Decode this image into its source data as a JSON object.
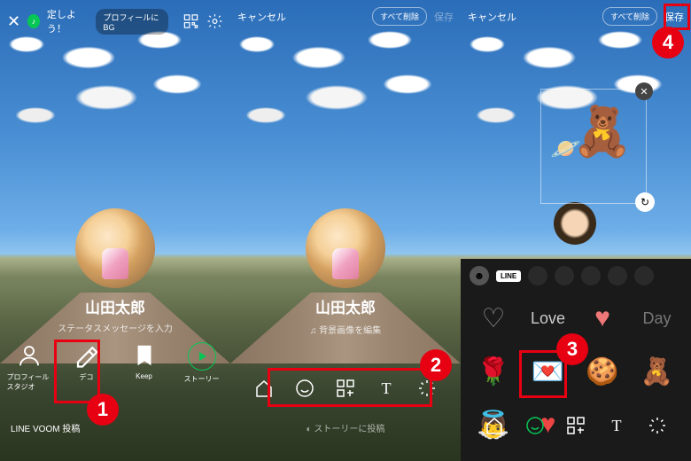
{
  "panel1": {
    "topbar": {
      "music_prompt": "定しよう！",
      "profile_bgm": "プロフィールにBG"
    },
    "profile": {
      "name": "山田太郎",
      "status": "ステータスメッセージを入力"
    },
    "bottom": {
      "items": [
        {
          "label": "プロフィールスタジオ"
        },
        {
          "label": "デコ"
        },
        {
          "label": "Keep"
        },
        {
          "label": "ストーリー"
        }
      ]
    },
    "voom": "LINE VOOM 投稿"
  },
  "panel2": {
    "topbar": {
      "cancel": "キャンセル",
      "clear_all": "すべて削除",
      "save": "保存"
    },
    "profile": {
      "name": "山田太郎",
      "bg_edit": "背景画像を編集"
    },
    "story_post": "ストーリーに投稿"
  },
  "panel3": {
    "topbar": {
      "cancel": "キャンセル",
      "clear_all": "すべて削除",
      "save": "保存"
    },
    "sticker_tabs": {
      "line": "LINE"
    },
    "grid_text": {
      "love": "Love",
      "day": "Day"
    }
  },
  "callouts": {
    "c1": "1",
    "c2": "2",
    "c3": "3",
    "c4": "4"
  }
}
